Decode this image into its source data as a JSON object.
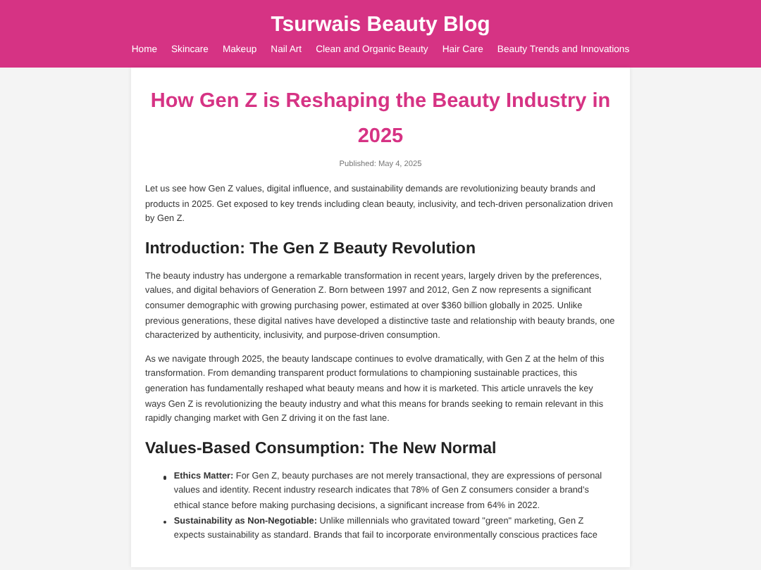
{
  "site_title": "Tsurwais Beauty Blog",
  "nav": [
    "Home",
    "Skincare",
    "Makeup",
    "Nail Art",
    "Clean and Organic Beauty",
    "Hair Care",
    "Beauty Trends and Innovations"
  ],
  "article": {
    "title": "How Gen Z is Reshaping the Beauty Industry in 2025",
    "published": "Published: May 4, 2025",
    "blocks": [
      {
        "kind": "paragraph",
        "text": "Let us see how Gen Z values, digital influence, and sustainability demands are revolutionizing beauty brands and products in 2025. Get exposed to key trends including clean beauty, inclusivity, and tech-driven personalization driven by Gen Z."
      },
      {
        "kind": "heading",
        "text": "Introduction: The Gen Z Beauty Revolution"
      },
      {
        "kind": "paragraph",
        "text": "The beauty industry has undergone a remarkable transformation in recent years, largely driven by the preferences, values, and digital behaviors of Generation Z. Born between 1997 and 2012, Gen Z now represents a significant consumer demographic with growing purchasing power, estimated at over $360 billion globally in 2025. Unlike previous generations, these digital natives have developed a distinctive taste and relationship with beauty brands, one characterized by authenticity, inclusivity, and purpose-driven consumption."
      },
      {
        "kind": "paragraph",
        "text": "As we navigate through 2025, the beauty landscape continues to evolve dramatically, with Gen Z at the helm of this transformation. From demanding transparent product formulations to championing sustainable practices, this generation has fundamentally reshaped what beauty means and how it is marketed. This article unravels the key ways Gen Z is revolutionizing the beauty industry and what this means for brands seeking to remain relevant in this rapidly changing market with Gen Z driving it on the fast lane."
      },
      {
        "kind": "heading",
        "text": "Values-Based Consumption: The New Normal"
      },
      {
        "kind": "list",
        "items": [
          {
            "text": "**Ethics Matter:** For Gen Z, beauty purchases are not merely transactional, they are expressions of personal values and identity. Recent industry research indicates that 78% of Gen Z consumers consider a brand's ethical stance before making purchasing decisions, a significant increase from 64% in 2022."
          },
          {
            "text": "**Sustainability as Non-Negotiable:** Unlike millennials who gravitated toward \"green\" marketing, Gen Z expects sustainability as standard. Brands that fail to incorporate environmentally conscious practices face"
          }
        ]
      }
    ]
  }
}
